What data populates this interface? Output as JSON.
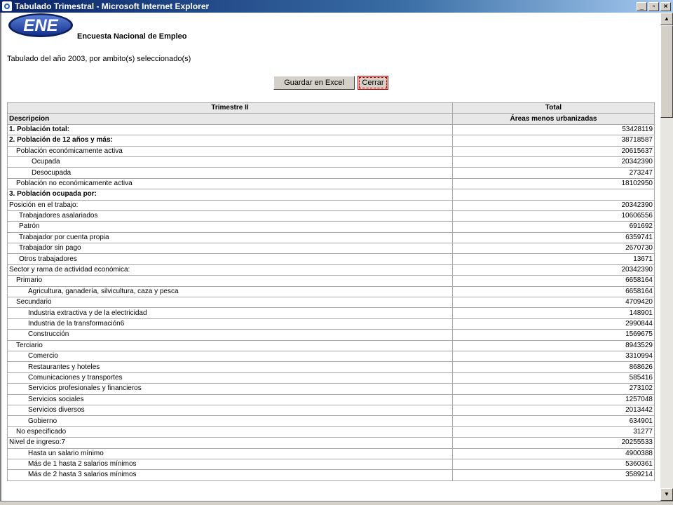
{
  "window": {
    "title": "Tabulado Trimestral - Microsoft Internet Explorer",
    "controls": [
      "_",
      "▫",
      "×"
    ]
  },
  "header": {
    "logo_text": "ENE",
    "logo_caption": "Encuesta Nacional de Empleo",
    "subtitle": "Tabulado del año 2003, por ambito(s) seleccionado(s)"
  },
  "buttons": {
    "excel_label": "Guardar en Excel",
    "close_label": "Cerrar"
  },
  "table": {
    "header_row1": [
      "Trimestre II",
      "Total"
    ],
    "header_row2": [
      "Descripcion",
      "Áreas menos urbanizadas"
    ],
    "rows": [
      {
        "label": "1. Población total:",
        "value": "53428119",
        "bold": true,
        "indent": 0
      },
      {
        "label": "2. Población de 12 años y más:",
        "value": "38718587",
        "bold": true,
        "indent": 0
      },
      {
        "label": "Población económicamente activa",
        "value": "20615637",
        "bold": false,
        "indent": 1
      },
      {
        "label": "Ocupada",
        "value": "20342390",
        "bold": false,
        "indent": 2
      },
      {
        "label": "Desocupada",
        "value": "273247",
        "bold": false,
        "indent": 2
      },
      {
        "label": "Población no económicamente activa",
        "value": "18102950",
        "bold": false,
        "indent": 1
      },
      {
        "label": "3. Población ocupada por:",
        "value": "",
        "bold": true,
        "indent": 0
      },
      {
        "label": "Posición en el trabajo:",
        "value": "20342390",
        "bold": false,
        "indent": 0
      },
      {
        "label": "Trabajadores asalariados",
        "value": "10606556",
        "bold": false,
        "indent": 4
      },
      {
        "label": "Patrón",
        "value": "691692",
        "bold": false,
        "indent": 4
      },
      {
        "label": "Trabajador por cuenta propia",
        "value": "6359741",
        "bold": false,
        "indent": 4
      },
      {
        "label": "Trabajador sin pago",
        "value": "2670730",
        "bold": false,
        "indent": 4
      },
      {
        "label": "Otros trabajadores",
        "value": "13671",
        "bold": false,
        "indent": 4
      },
      {
        "label": "Sector y rama de actividad económica:",
        "value": "20342390",
        "bold": false,
        "indent": 0
      },
      {
        "label": "Primario",
        "value": "6658164",
        "bold": false,
        "indent": 1
      },
      {
        "label": "Agricultura, ganadería, silvicultura, caza y pesca",
        "value": "6658164",
        "bold": false,
        "indent": 3
      },
      {
        "label": "Secundario",
        "value": "4709420",
        "bold": false,
        "indent": 1
      },
      {
        "label": "Industria extractiva y de la electricidad",
        "value": "148901",
        "bold": false,
        "indent": 3
      },
      {
        "label": "Industria de la transformación6",
        "value": "2990844",
        "bold": false,
        "indent": 3
      },
      {
        "label": "Construcción",
        "value": "1569675",
        "bold": false,
        "indent": 3
      },
      {
        "label": "Terciario",
        "value": "8943529",
        "bold": false,
        "indent": 1
      },
      {
        "label": "Comercio",
        "value": "3310994",
        "bold": false,
        "indent": 3
      },
      {
        "label": "Restaurantes y hoteles",
        "value": "868626",
        "bold": false,
        "indent": 3
      },
      {
        "label": "Comunicaciones y transportes",
        "value": "585416",
        "bold": false,
        "indent": 3
      },
      {
        "label": "Servicios profesionales y financieros",
        "value": "273102",
        "bold": false,
        "indent": 3
      },
      {
        "label": "Servicios sociales",
        "value": "1257048",
        "bold": false,
        "indent": 3
      },
      {
        "label": "Servicios diversos",
        "value": "2013442",
        "bold": false,
        "indent": 3
      },
      {
        "label": "Gobierno",
        "value": "634901",
        "bold": false,
        "indent": 3
      },
      {
        "label": "No especificado",
        "value": "31277",
        "bold": false,
        "indent": 1
      },
      {
        "label": "Nivel de ingreso:7",
        "value": "20255533",
        "bold": false,
        "indent": 0
      },
      {
        "label": "Hasta un salario mínimo",
        "value": "4900388",
        "bold": false,
        "indent": 5
      },
      {
        "label": "Más de 1 hasta 2 salarios mínimos",
        "value": "5360361",
        "bold": false,
        "indent": 5
      },
      {
        "label": "Más de 2 hasta 3 salarios mínimos",
        "value": "3589214",
        "bold": false,
        "indent": 5
      }
    ]
  },
  "colors": {
    "titlebar": "#0a246a",
    "logo_blue": "#1c3f9c",
    "header_bg": "#e8e8e8"
  }
}
